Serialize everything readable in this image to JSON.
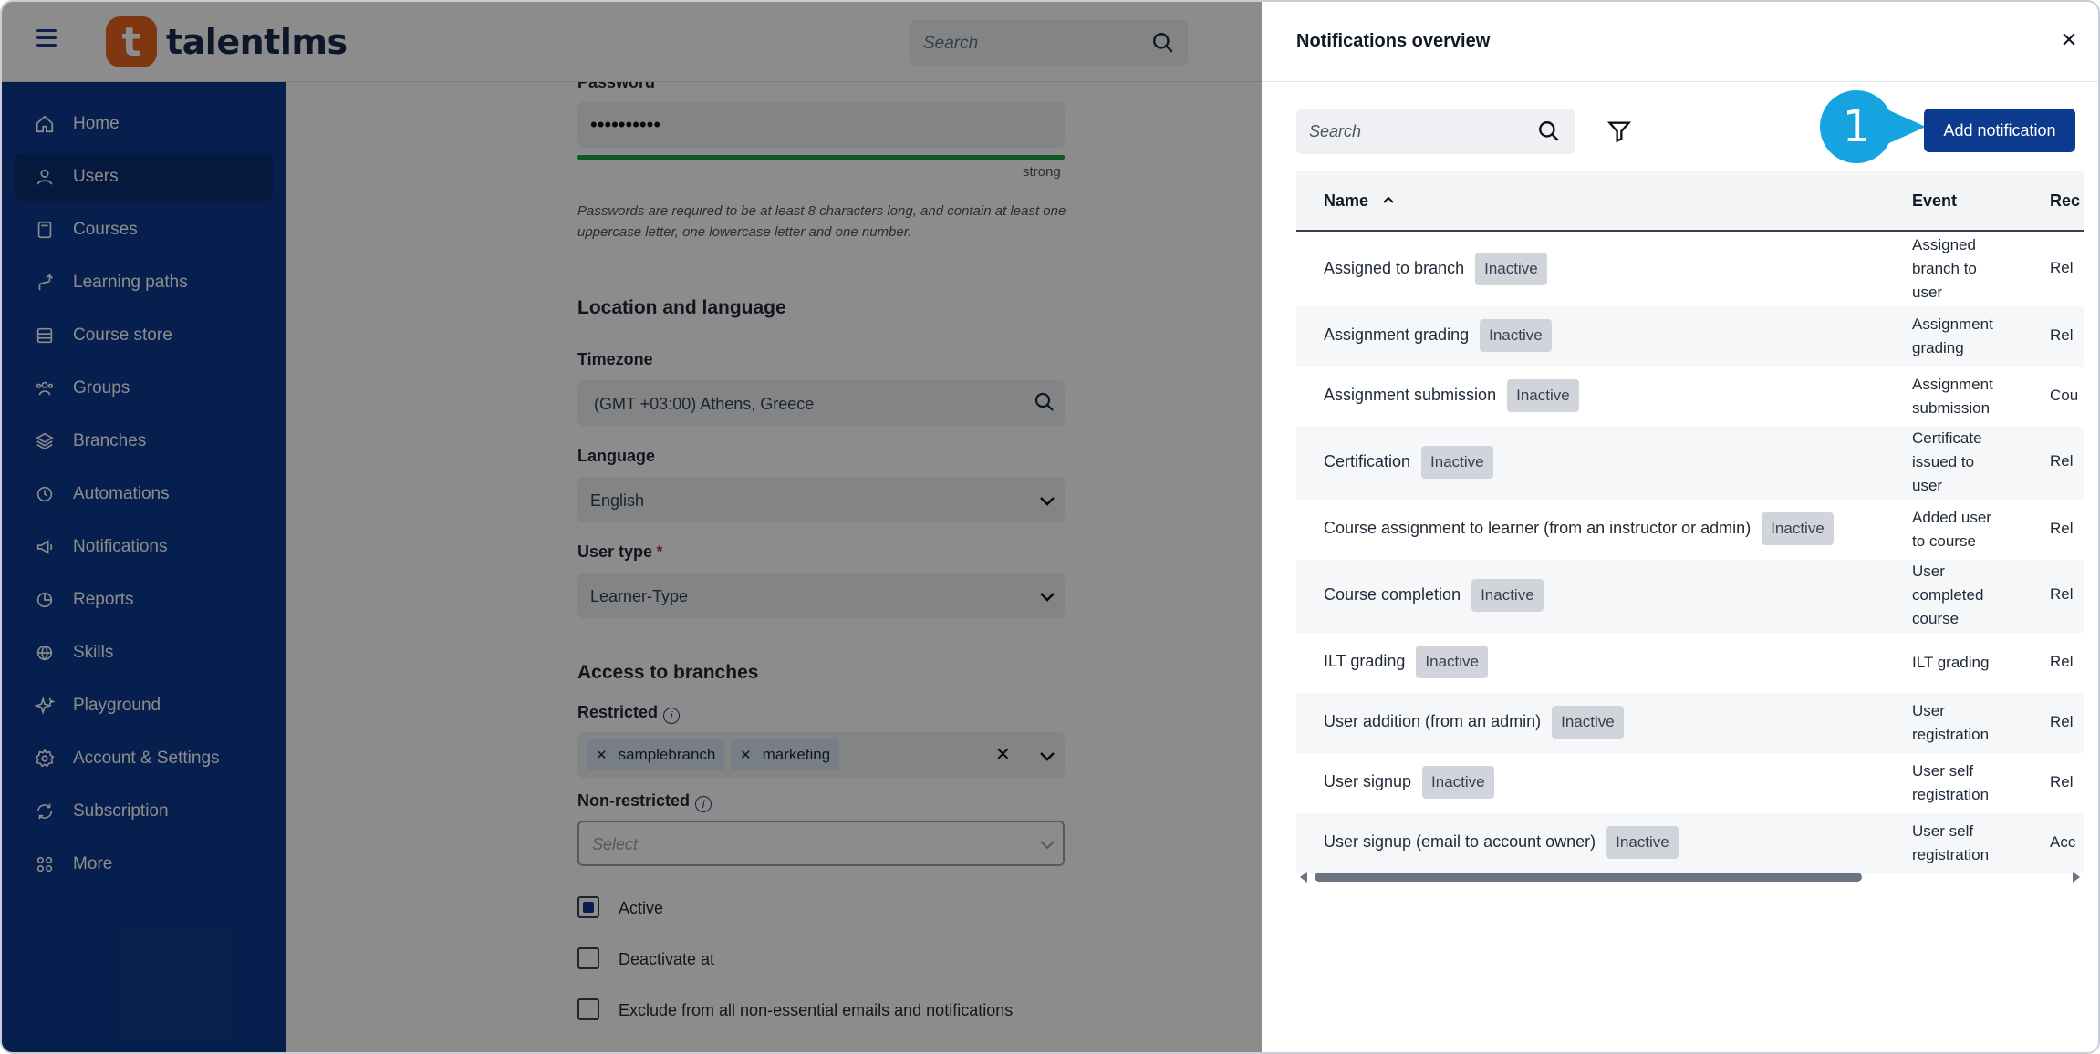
{
  "app": {
    "logo_mark": "t",
    "logo_text": "talentlms",
    "search_placeholder": "Search"
  },
  "sidebar": {
    "items": [
      {
        "label": "Home",
        "icon": "home-icon"
      },
      {
        "label": "Users",
        "icon": "user-icon",
        "active": true
      },
      {
        "label": "Courses",
        "icon": "book-icon"
      },
      {
        "label": "Learning paths",
        "icon": "path-icon"
      },
      {
        "label": "Course store",
        "icon": "store-icon"
      },
      {
        "label": "Groups",
        "icon": "groups-icon"
      },
      {
        "label": "Branches",
        "icon": "layers-icon"
      },
      {
        "label": "Automations",
        "icon": "automation-icon"
      },
      {
        "label": "Notifications",
        "icon": "megaphone-icon"
      },
      {
        "label": "Reports",
        "icon": "pie-chart-icon"
      },
      {
        "label": "Skills",
        "icon": "skills-icon"
      },
      {
        "label": "Playground",
        "icon": "sparkle-icon"
      },
      {
        "label": "Account & Settings",
        "icon": "gear-icon"
      },
      {
        "label": "Subscription",
        "icon": "subscription-icon"
      },
      {
        "label": "More",
        "icon": "grid-icon"
      }
    ]
  },
  "form": {
    "password_label": "Password",
    "password_value": "••••••••••",
    "strength_label": "strong",
    "password_help": "Passwords are required to be at least 8 characters long, and contain at least one uppercase letter, one lowercase letter and one number.",
    "location_title": "Location and language",
    "timezone_label": "Timezone",
    "timezone_value": "(GMT +03:00) Athens, Greece",
    "language_label": "Language",
    "language_value": "English",
    "user_type_label": "User type",
    "required_mark": "*",
    "user_type_value": "Learner-Type",
    "branches_title": "Access to branches",
    "restricted_label": "Restricted",
    "restricted_tags": [
      "samplebranch",
      "marketing"
    ],
    "nonrestricted_label": "Non-restricted",
    "nonrestricted_placeholder": "Select",
    "active_label": "Active",
    "deactivate_label": "Deactivate at",
    "exclude_label": "Exclude from all non-essential emails and notifications"
  },
  "panel": {
    "title": "Notifications overview",
    "search_placeholder": "Search",
    "add_button": "Add notification",
    "step_number": "1",
    "columns": {
      "name": "Name",
      "event": "Event",
      "recipient": "Rec"
    },
    "rows": [
      {
        "name": "Assigned to branch",
        "status": "Inactive",
        "event": "Assigned branch to user",
        "recipient": "Rel"
      },
      {
        "name": "Assignment grading",
        "status": "Inactive",
        "event": "Assignment grading",
        "recipient": "Rel"
      },
      {
        "name": "Assignment submission",
        "status": "Inactive",
        "event": "Assignment submission",
        "recipient": "Cou"
      },
      {
        "name": "Certification",
        "status": "Inactive",
        "event": "Certificate issued to user",
        "recipient": "Rel"
      },
      {
        "name": "Course assignment to learner (from an instructor or admin)",
        "status": "Inactive",
        "event": "Added user to course",
        "recipient": "Rel"
      },
      {
        "name": "Course completion",
        "status": "Inactive",
        "event": "User completed course",
        "recipient": "Rel"
      },
      {
        "name": "ILT grading",
        "status": "Inactive",
        "event": "ILT grading",
        "recipient": "Rel"
      },
      {
        "name": "User addition (from an admin)",
        "status": "Inactive",
        "event": "User registration",
        "recipient": "Rel"
      },
      {
        "name": "User signup",
        "status": "Inactive",
        "event": "User self registration",
        "recipient": "Rel"
      },
      {
        "name": "User signup (email to account owner)",
        "status": "Inactive",
        "event": "User self registration",
        "recipient": "Acc"
      }
    ]
  },
  "colors": {
    "sidebar_bg": "#0d3a8e",
    "accent": "#0d3a8e",
    "brand_orange": "#e8641f",
    "step_marker": "#16a4e0"
  }
}
